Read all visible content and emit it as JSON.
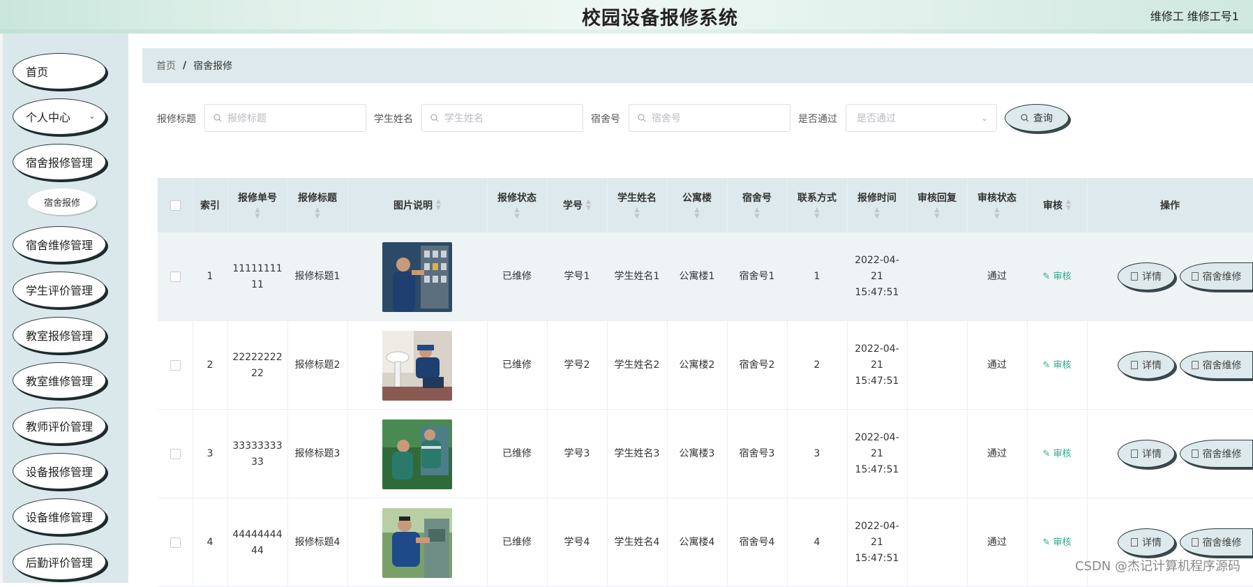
{
  "header": {
    "title": "校园设备报修系统",
    "user": "维修工 维修工号1"
  },
  "sidebar": {
    "items": [
      {
        "label": "首页"
      },
      {
        "label": "个人中心"
      },
      {
        "label": "宿舍报修管理"
      },
      {
        "label": "宿舍报修"
      },
      {
        "label": "宿舍维修管理"
      },
      {
        "label": "学生评价管理"
      },
      {
        "label": "教室报修管理"
      },
      {
        "label": "教室维修管理"
      },
      {
        "label": "教师评价管理"
      },
      {
        "label": "设备报修管理"
      },
      {
        "label": "设备维修管理"
      },
      {
        "label": "后勤评价管理"
      }
    ]
  },
  "breadcrumb": {
    "home": "首页",
    "separator": "/",
    "current": "宿舍报修"
  },
  "search": {
    "title_label": "报修标题",
    "title_placeholder": "报修标题",
    "name_label": "学生姓名",
    "name_placeholder": "学生姓名",
    "room_label": "宿舍号",
    "room_placeholder": "宿舍号",
    "pass_label": "是否通过",
    "pass_placeholder": "是否通过",
    "query_button": "查询"
  },
  "table": {
    "headers": [
      "索引",
      "报修单号",
      "报修标题",
      "图片说明",
      "报修状态",
      "学号",
      "学生姓名",
      "公寓楼",
      "宿舍号",
      "联系方式",
      "报修时间",
      "审核回复",
      "审核状态",
      "审核",
      "操作"
    ],
    "rows": [
      {
        "index": "1",
        "order_no": "1111111111",
        "title": "报修标题1",
        "status": "已维修",
        "student_no": "学号1",
        "student_name": "学生姓名1",
        "building": "公寓楼1",
        "room": "宿舍号1",
        "contact": "1",
        "time": "2022-04-21 15:47:51",
        "reply": "",
        "audit_status": "通过",
        "audit_link": "审核"
      },
      {
        "index": "2",
        "order_no": "2222222222",
        "title": "报修标题2",
        "status": "已维修",
        "student_no": "学号2",
        "student_name": "学生姓名2",
        "building": "公寓楼2",
        "room": "宿舍号2",
        "contact": "2",
        "time": "2022-04-21 15:47:51",
        "reply": "",
        "audit_status": "通过",
        "audit_link": "审核"
      },
      {
        "index": "3",
        "order_no": "3333333333",
        "title": "报修标题3",
        "status": "已维修",
        "student_no": "学号3",
        "student_name": "学生姓名3",
        "building": "公寓楼3",
        "room": "宿舍号3",
        "contact": "3",
        "time": "2022-04-21 15:47:51",
        "reply": "",
        "audit_status": "通过",
        "audit_link": "审核"
      },
      {
        "index": "4",
        "order_no": "4444444444",
        "title": "报修标题4",
        "status": "已维修",
        "student_no": "学号4",
        "student_name": "学生姓名4",
        "building": "公寓楼4",
        "room": "宿舍号4",
        "contact": "4",
        "time": "2022-04-21 15:47:51",
        "reply": "",
        "audit_status": "通过",
        "audit_link": "审核"
      }
    ],
    "actions": {
      "detail": "详情",
      "repair": "宿舍维修"
    }
  },
  "watermark": "CSDN @杰记计算机程序源码",
  "colors": {
    "accent": "#2fa88a",
    "header_bg": "#dde9ec",
    "sidebar_bg": "#dbe8eb"
  }
}
